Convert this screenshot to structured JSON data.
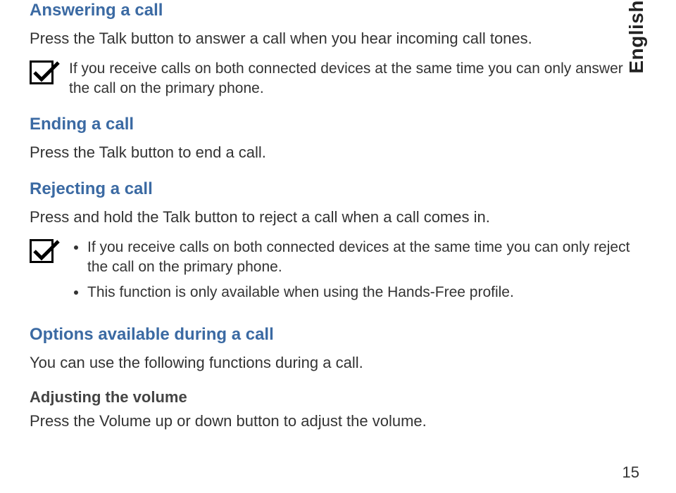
{
  "sideTab": "English",
  "sections": {
    "answering": {
      "title": "Answering a call",
      "body": "Press the Talk button to answer a call when you hear incoming call tones.",
      "note": "If you receive calls on both connected devices at the same time you can only answer the call on the primary phone."
    },
    "ending": {
      "title": "Ending a call",
      "body": "Press the Talk button to end a call."
    },
    "rejecting": {
      "title": "Rejecting a call",
      "body": "Press and hold the Talk button to reject a call when a call comes in.",
      "notes": [
        "If you receive calls on both connected devices at the same time you can only reject the call on the primary phone.",
        "This function is only available when using the Hands-Free profile."
      ]
    },
    "options": {
      "title": "Options available during a call",
      "body": "You can use the following functions during a call."
    },
    "adjusting": {
      "title": "Adjusting the volume",
      "body": "Press the Volume up or down button to adjust the volume."
    }
  },
  "pageNumber": "15"
}
